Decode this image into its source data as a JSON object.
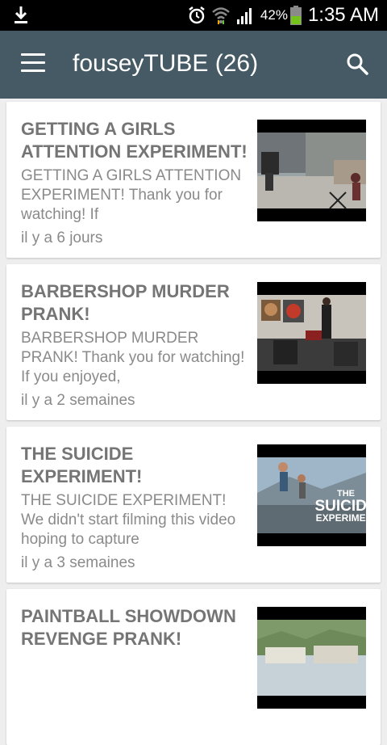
{
  "status_bar": {
    "battery": "42%",
    "time": "1:35 AM"
  },
  "app_bar": {
    "title": "fouseyTUBE (26)",
    "menu_icon": "hamburger-menu-icon",
    "search_icon": "search-icon",
    "color": "#455a64"
  },
  "videos": [
    {
      "title": "GETTING A GIRLS ATTENTION EXPERIMENT!",
      "description": "GETTING A GIRLS ATTENTION EXPERIMENT! Thank you for watching! If",
      "time": "il y a 6 jours"
    },
    {
      "title": "BARBERSHOP MURDER PRANK!",
      "description": "BARBERSHOP MURDER PRANK! Thank you for watching! If you enjoyed,",
      "time": "il y a 2 semaines"
    },
    {
      "title": "THE SUICIDE EXPERIMENT!",
      "description": "THE SUICIDE EXPERIMENT! We didn't start filming this video hoping to capture",
      "time": "il y a 3 semaines",
      "thumbnail_text": [
        "THE",
        "SUICIDE",
        "EXPERIMEN"
      ]
    },
    {
      "title": "PAINTBALL SHOWDOWN REVENGE PRANK!",
      "description": "",
      "time": ""
    }
  ]
}
